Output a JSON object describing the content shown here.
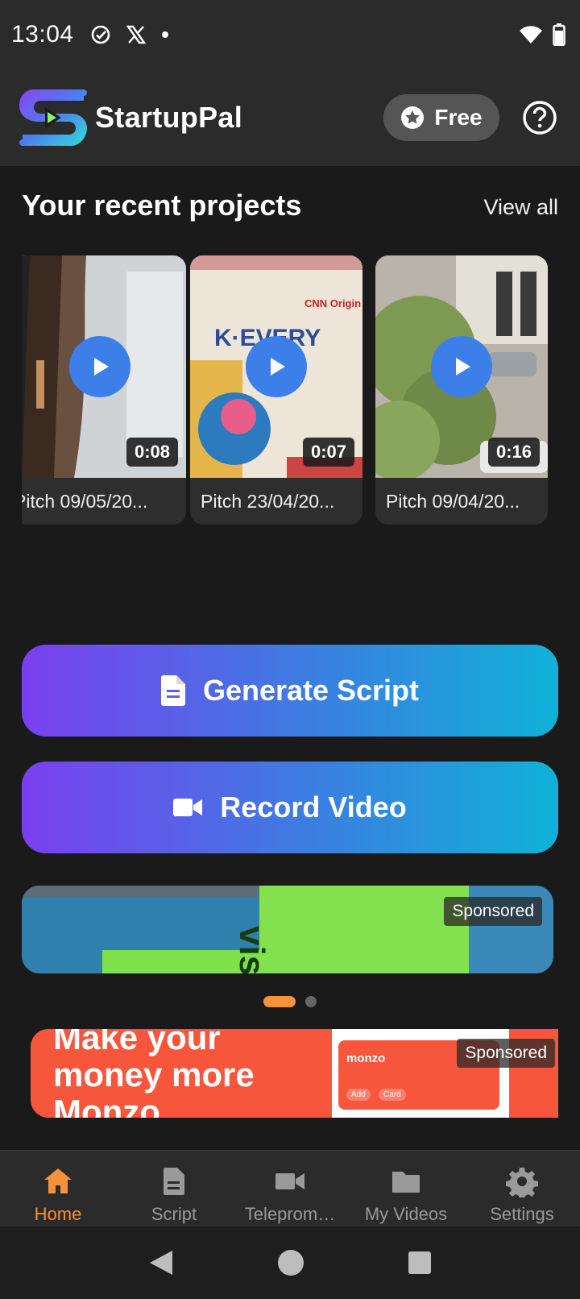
{
  "status_bar": {
    "time": "13:04"
  },
  "header": {
    "brand": "StartupPal",
    "plan_label": "Free"
  },
  "recent": {
    "title": "Your recent projects",
    "view_all": "View all",
    "projects": [
      {
        "caption": "Pitch 09/05/20...",
        "duration": "0:08"
      },
      {
        "caption": "Pitch 23/04/20...",
        "duration": "0:07"
      },
      {
        "caption": "Pitch 09/04/20...",
        "duration": "0:16"
      }
    ]
  },
  "actions": {
    "generate_script": "Generate Script",
    "record_video": "Record Video"
  },
  "ads": {
    "ad1": {
      "sponsored": "Sponsored",
      "brand_fragment": "vise"
    },
    "ad2": {
      "sponsored": "Sponsored",
      "headline": "Make your money more Monzo",
      "card_brand": "monzo",
      "chip_add": "Add",
      "chip_card": "Card"
    }
  },
  "carousel": {
    "active_index": 0,
    "count": 2
  },
  "nav": {
    "items": [
      {
        "label": "Home",
        "icon": "home-icon",
        "active": true
      },
      {
        "label": "Script",
        "icon": "document-icon",
        "active": false
      },
      {
        "label": "Teleprompter",
        "display": "Teleprom…",
        "icon": "video-camera-icon",
        "active": false
      },
      {
        "label": "My Videos",
        "icon": "folder-icon",
        "active": false
      },
      {
        "label": "Settings",
        "icon": "gear-icon",
        "active": false
      }
    ]
  },
  "colors": {
    "accent": "#f5923a",
    "gradient_start": "#7b3ff0",
    "gradient_end": "#10b2d8",
    "play": "#3d7fe8"
  }
}
